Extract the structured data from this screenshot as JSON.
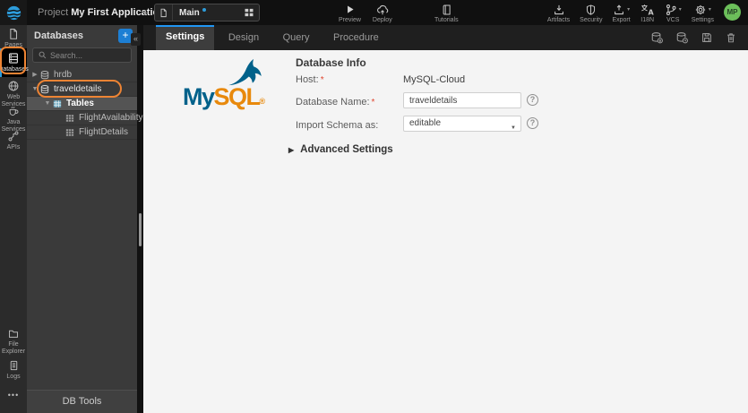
{
  "topbar": {
    "project_prefix": "Project",
    "project_name": "My First Application",
    "page": {
      "name": "Main"
    },
    "actions": {
      "preview": "Preview",
      "deploy": "Deploy",
      "tutorials": "Tutorials",
      "artifacts": "Artifacts",
      "security": "Security",
      "export": "Export",
      "i18n": "I18N",
      "vcs": "VCS",
      "settings": "Settings"
    },
    "avatar_initials": "MP"
  },
  "sidebar": {
    "items": [
      {
        "label": "Pages"
      },
      {
        "label": "Databases",
        "active": true,
        "annotated": true
      },
      {
        "label": "Web Services"
      },
      {
        "label": "Java Services"
      },
      {
        "label": "APIs"
      }
    ],
    "bottom_items": [
      {
        "label": "File Explorer"
      },
      {
        "label": "Logs"
      }
    ],
    "more": "•••"
  },
  "db_panel": {
    "title": "Databases",
    "add_button": "+",
    "collapse_button": "«",
    "search_placeholder": "Search...",
    "tree": [
      {
        "label": "hrdb",
        "type": "database",
        "state": "collapsed"
      },
      {
        "label": "traveldetails",
        "type": "database",
        "state": "expanded",
        "annotated": true
      },
      {
        "label": "Tables",
        "type": "table-folder",
        "state": "expanded",
        "selected": true
      },
      {
        "label": "FlightAvailability",
        "type": "table"
      },
      {
        "label": "FlightDetails",
        "type": "table"
      }
    ],
    "footer": "DB Tools"
  },
  "workspace": {
    "tabs": [
      {
        "label": "Settings",
        "active": true
      },
      {
        "label": "Design"
      },
      {
        "label": "Query"
      },
      {
        "label": "Procedure"
      }
    ]
  },
  "content": {
    "logo": {
      "my": "My",
      "sql": "SQL",
      "registered": "®"
    },
    "section_title": "Database Info",
    "required_marker": "*",
    "fields": {
      "host": {
        "label": "Host:",
        "value": "MySQL-Cloud"
      },
      "db_name": {
        "label": "Database Name:",
        "value": "traveldetails"
      },
      "import_schema": {
        "label": "Import Schema as:",
        "value": "editable"
      }
    },
    "advanced_toggle": "Advanced Settings"
  },
  "colors": {
    "accent_blue": "#2d9cdb",
    "tab_indicator": "#2196f3",
    "annotation_orange": "#ee8434",
    "avatar_green": "#6cbf5a",
    "mysql_blue": "#00618a",
    "mysql_orange": "#e8890c",
    "selected_row_gray": "#545454"
  }
}
